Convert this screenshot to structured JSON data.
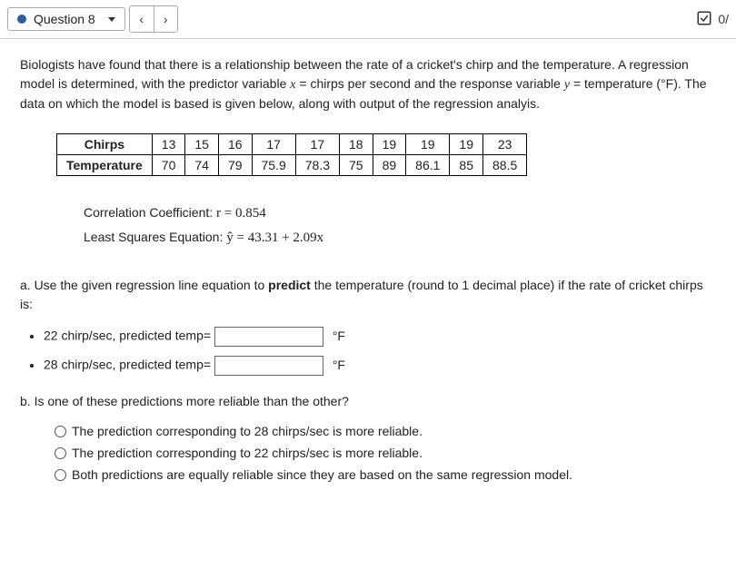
{
  "topbar": {
    "question_label": "Question 8",
    "prev_symbol": "‹",
    "next_symbol": "›",
    "tries_text": "0/"
  },
  "intro": {
    "text_1": "Biologists have found that there is a relationship between the rate of a cricket's chirp and the temperature. A regression model is determined, with the predictor variable ",
    "var_x": "x",
    "text_2": " = chirps per second and the response variable ",
    "var_y": "y",
    "text_3": " = temperature (°F). The data on which the model is based is given below, along with output of the regression analyis."
  },
  "data_table": {
    "row_labels": [
      "Chirps",
      "Temperature"
    ],
    "chirps": [
      "13",
      "15",
      "16",
      "17",
      "17",
      "18",
      "19",
      "19",
      "19",
      "23"
    ],
    "temperature": [
      "70",
      "74",
      "79",
      "75.9",
      "78.3",
      "75",
      "89",
      "86.1",
      "85",
      "88.5"
    ]
  },
  "analysis": {
    "corr_label": "Correlation Coefficient:  ",
    "corr_eq": "r = 0.854",
    "lsq_label": "Least Squares Equation:  ",
    "lsq_eq": "ŷ = 43.31 + 2.09x"
  },
  "part_a": {
    "prompt_1": "a. Use the given regression line equation to ",
    "predict_word": "predict",
    "prompt_2": " the temperature (round to 1 decimal place) if the rate of cricket chirps is:",
    "items": [
      {
        "label": "22 chirp/sec, predicted temp=",
        "unit": "°F"
      },
      {
        "label": "28 chirp/sec, predicted temp=",
        "unit": "°F"
      }
    ]
  },
  "part_b": {
    "prompt": "b. Is one of these predictions more reliable than the other?",
    "options": [
      "The prediction corresponding to 28 chirps/sec is more reliable.",
      "The prediction corresponding to 22 chirps/sec is more reliable.",
      "Both predictions are equally reliable since they are based on the same regression model."
    ]
  },
  "chart_data": {
    "type": "table",
    "columns": [
      "Chirps",
      "Temperature"
    ],
    "rows": [
      [
        13,
        70
      ],
      [
        15,
        74
      ],
      [
        16,
        79
      ],
      [
        17,
        75.9
      ],
      [
        17,
        78.3
      ],
      [
        18,
        75
      ],
      [
        19,
        89
      ],
      [
        19,
        86.1
      ],
      [
        19,
        85
      ],
      [
        23,
        88.5
      ]
    ],
    "regression": {
      "intercept": 43.31,
      "slope": 2.09,
      "r": 0.854
    }
  }
}
